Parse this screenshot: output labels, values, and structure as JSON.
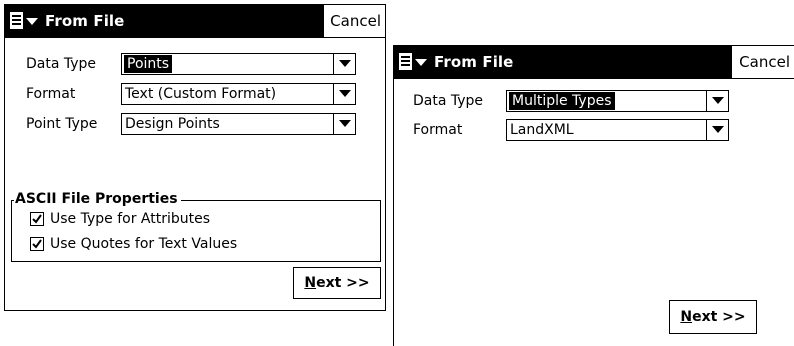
{
  "window1": {
    "title": "From File",
    "cancel": "Cancel",
    "data_type": {
      "label": "Data Type",
      "value": "Points"
    },
    "format": {
      "label": "Format",
      "value": "Text (Custom Format)"
    },
    "point_type": {
      "label": "Point Type",
      "value": "Design Points"
    },
    "ascii_group": {
      "title": "ASCII File Properties",
      "use_type": {
        "label": "Use Type for Attributes",
        "checked": true
      },
      "use_quotes": {
        "label": "Use Quotes for Text Values",
        "checked": true
      }
    },
    "next": {
      "mnemonic": "N",
      "rest": "ext >>"
    }
  },
  "window2": {
    "title": "From File",
    "cancel": "Cancel",
    "data_type": {
      "label": "Data Type",
      "value": "Multiple Types"
    },
    "format": {
      "label": "Format",
      "value": "LandXML"
    },
    "next": {
      "mnemonic": "N",
      "rest": "ext >>"
    }
  }
}
